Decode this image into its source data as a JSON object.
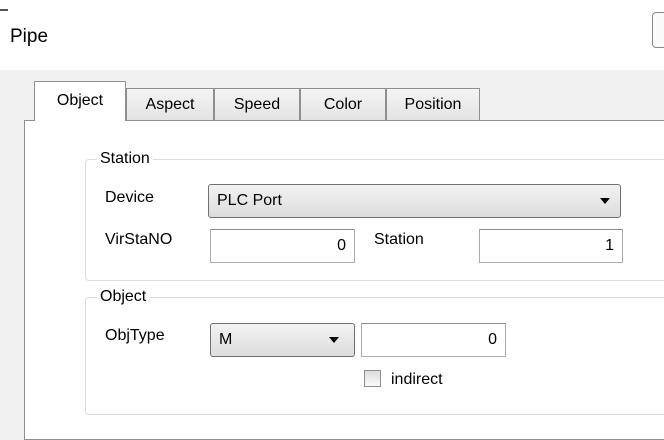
{
  "window": {
    "title": "Pipe"
  },
  "tabs": [
    {
      "label": "Object",
      "active": true
    },
    {
      "label": "Aspect",
      "active": false
    },
    {
      "label": "Speed",
      "active": false
    },
    {
      "label": "Color",
      "active": false
    },
    {
      "label": "Position",
      "active": false
    }
  ],
  "station_group": {
    "legend": "Station",
    "device_label": "Device",
    "device_value": "PLC Port",
    "virstano_label": "VirStaNO",
    "virstano_value": "0",
    "station_label": "Station",
    "station_value": "1"
  },
  "object_group": {
    "legend": "Object",
    "objtype_label": "ObjType",
    "objtype_value": "M",
    "address_value": "0",
    "indirect_label": "indirect",
    "indirect_checked": false
  },
  "colors": {
    "panel_bg": "#ffffff",
    "dialog_bg": "#f0f0f0",
    "border": "#8e8f8f",
    "group_border": "#d5dfe5"
  },
  "icons": {
    "dropdown": "chevron-down-icon",
    "checkbox": "checkbox-icon"
  }
}
